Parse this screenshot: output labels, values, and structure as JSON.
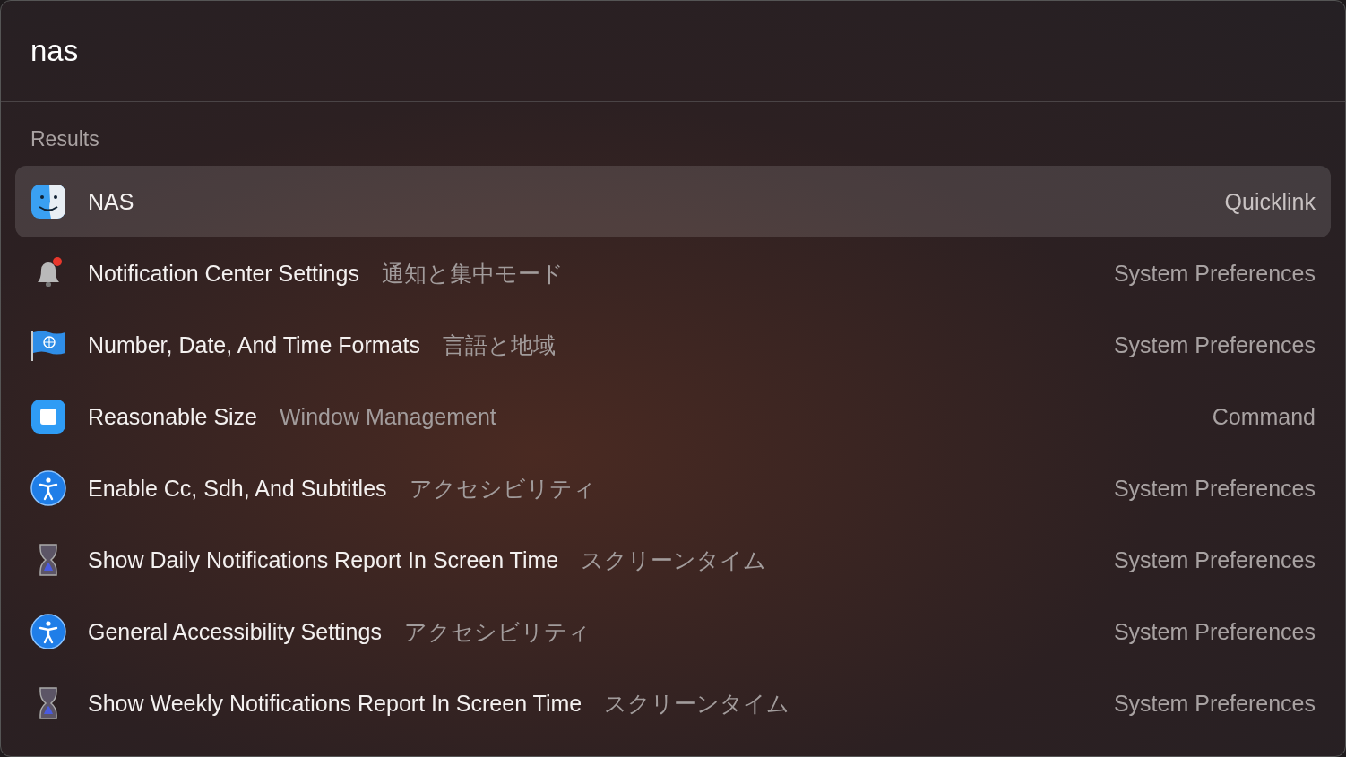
{
  "search": {
    "value": "nas"
  },
  "section_title": "Results",
  "results": [
    {
      "kind": "finder",
      "title": "NAS",
      "type": "Quicklink",
      "selected": true
    },
    {
      "kind": "bell",
      "title": "Notification Center Settings",
      "subtitle": "通知と集中モード",
      "type": "System Preferences",
      "selected": false
    },
    {
      "kind": "flag",
      "title": "Number, Date, And Time Formats",
      "subtitle": "言語と地域",
      "type": "System Preferences",
      "selected": false
    },
    {
      "kind": "window",
      "title": "Reasonable Size",
      "subtitle": "Window Management",
      "type": "Command",
      "selected": false
    },
    {
      "kind": "accessibility",
      "title": "Enable Cc, Sdh, And Subtitles",
      "subtitle": "アクセシビリティ",
      "type": "System Preferences",
      "selected": false
    },
    {
      "kind": "hourglass",
      "title": "Show Daily Notifications Report In Screen Time",
      "subtitle": "スクリーンタイム",
      "type": "System Preferences",
      "selected": false
    },
    {
      "kind": "accessibility",
      "title": "General Accessibility Settings",
      "subtitle": "アクセシビリティ",
      "type": "System Preferences",
      "selected": false
    },
    {
      "kind": "hourglass",
      "title": "Show Weekly Notifications Report In Screen Time",
      "subtitle": "スクリーンタイム",
      "type": "System Preferences",
      "selected": false
    }
  ]
}
